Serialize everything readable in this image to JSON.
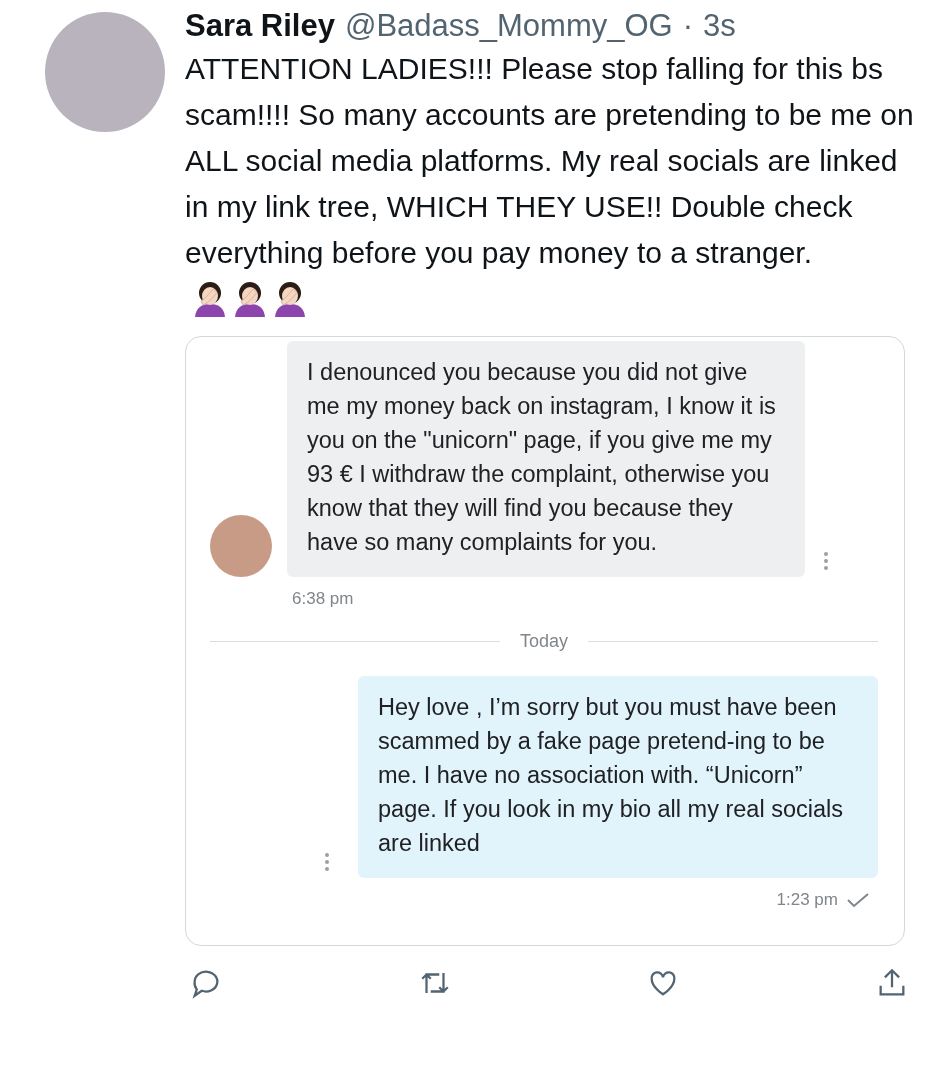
{
  "tweet": {
    "author": "Sara Riley",
    "handle": "@Badass_Mommy_OG",
    "separator": "·",
    "time": "3s",
    "text": "ATTENTION LADIES!!! Please stop falling for this bs scam!!!! So many accounts are pretending to be me on ALL social media platforms. My real socials are linked in my link tree, WHICH THEY USE!! Double check everything before you pay money to a stranger."
  },
  "attachment": {
    "messages": [
      {
        "kind": "received",
        "text": "I denounced you because you did not give me my money back on instagram, I know it is you on the \"unicorn\" page, if you give me my 93 € I withdraw the complaint, otherwise you know that they will find you because they have so many complaints for you.",
        "time": "6:38 pm"
      },
      {
        "kind": "divider",
        "label": "Today"
      },
      {
        "kind": "sent",
        "text": "Hey love , I’m sorry but you must have been scammed by a fake page pretend-ing to be me. I have no association with. “Unicorn” page. If you look in my bio all my real socials are linked",
        "time": "1:23 pm",
        "read": true
      }
    ]
  }
}
